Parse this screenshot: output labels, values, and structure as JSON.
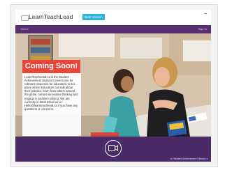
{
  "header": {
    "logo_text": "LearnTeachLead",
    "beta_label": "Beta Version",
    "top_link": "▪▪"
  },
  "nav": {
    "home": "Home",
    "sign_in": "Sign In"
  },
  "hero": {
    "banner": "Coming Soon!",
    "description": "LearnTeachLead.ca is the Student Achievement Division's new home for relevant resources for educators. It is a place where educators can talk about their practice, learn from others around the globe, nurture innovative thinking and engage in problem solving. We are currently in beta! Email us at Hello@learnteachlead.ca if you have any questions or concerns."
  },
  "video": {
    "icon": "video-camera-icon"
  },
  "footer": {
    "badge": "▪▪▪ Student Achievement Division ▪▪"
  },
  "colors": {
    "purple": "#4b2a68",
    "nav_purple": "#54306e",
    "banner_red": "#e8463b",
    "beta_blue": "#2bb3d8"
  }
}
